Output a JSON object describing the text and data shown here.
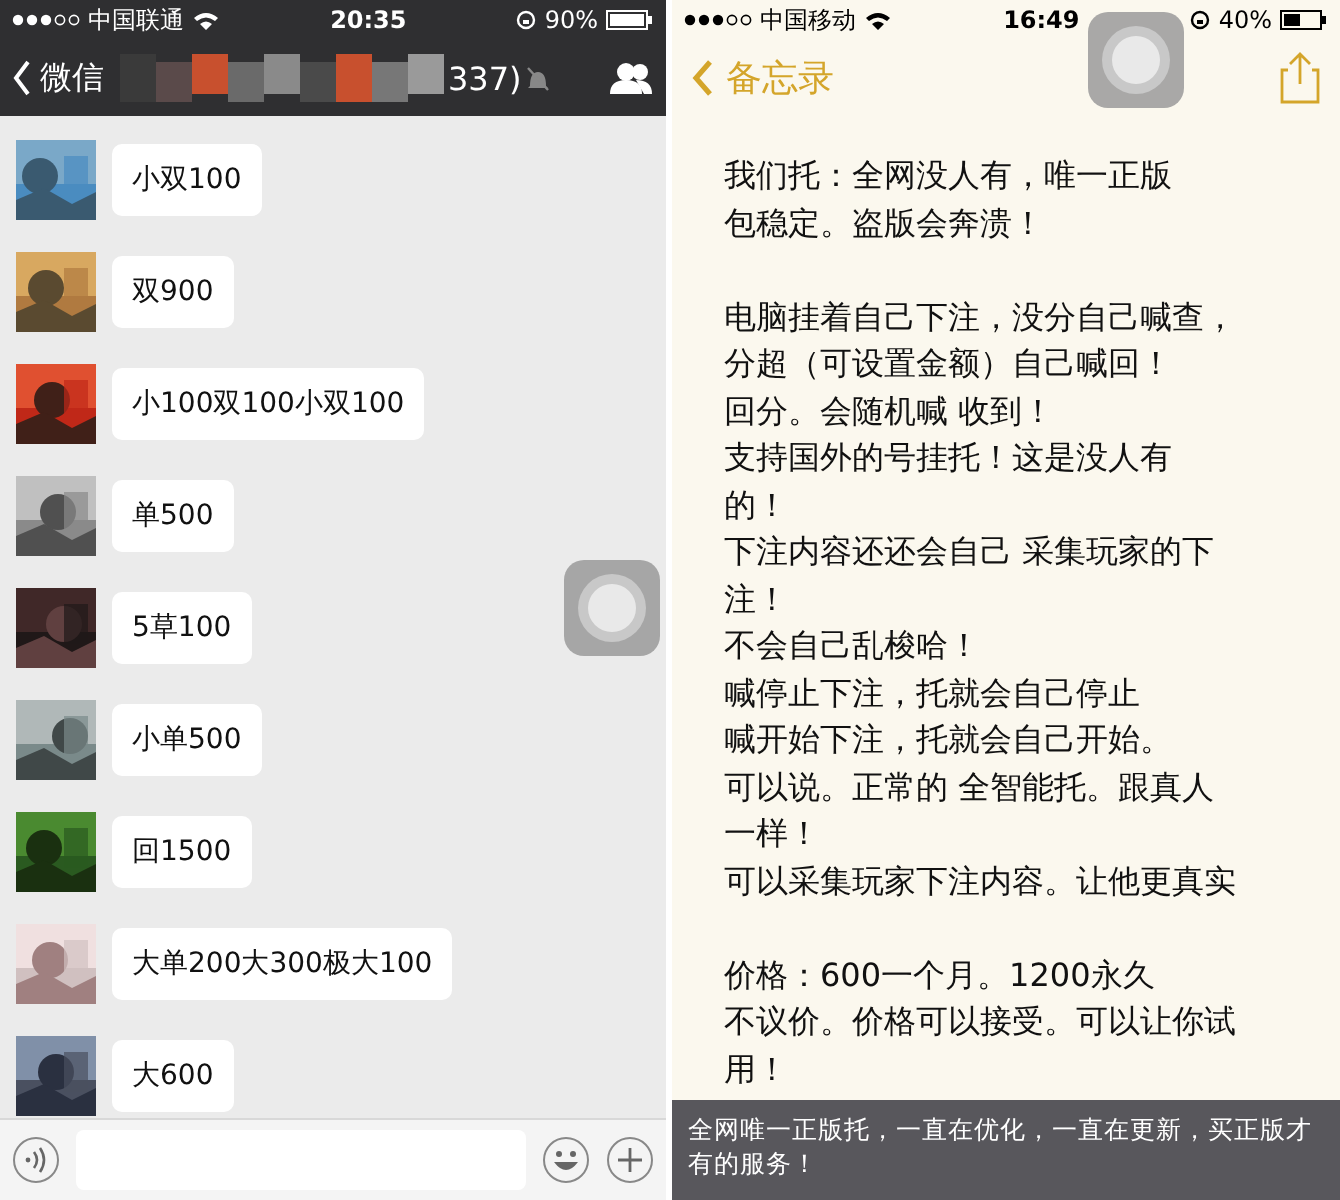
{
  "left_screen": {
    "status_bar": {
      "carrier": "中国联通",
      "time": "20:35",
      "battery": "90%"
    },
    "nav": {
      "back": "微信",
      "title": "337)"
    },
    "messages": [
      {
        "text": "小双100",
        "kind": "picture"
      },
      {
        "text": "双900",
        "kind": "picture"
      },
      {
        "text": "小100双100小双100",
        "kind": "picture"
      },
      {
        "text": "单500",
        "kind": "picture"
      },
      {
        "text": "5草100",
        "kind": "picture"
      },
      {
        "text": "小单500",
        "kind": "picture"
      },
      {
        "text": "回1500",
        "kind": "picture"
      },
      {
        "text": "大单200大300极大100",
        "kind": "picture"
      },
      {
        "text": "大600",
        "kind": "picture"
      }
    ]
  },
  "right_screen": {
    "status_bar": {
      "carrier": "中国移动",
      "time": "16:49",
      "battery": "40%"
    },
    "nav": {
      "back": "备忘录"
    },
    "note_paragraphs": [
      [
        "我们托：全网没人有，唯一正版",
        "包稳定。盗版会奔溃！"
      ],
      [
        "电脑挂着自己下注，没分自己喊查，",
        "分超（可设置金额）自己喊回！",
        "回分。会随机喊 收到！",
        "支持国外的号挂托！这是没人有",
        "的！",
        "下注内容还还会自己 采集玩家的下",
        "注！",
        "不会自己乱梭哈！",
        "喊停止下注，托就会自己停止",
        "喊开始下注，托就会自己开始。",
        "可以说。正常的 全智能托。跟真人",
        "一样！",
        "可以采集玩家下注内容。让他更真实"
      ],
      [
        "价格：600一个月。1200永久",
        "不议价。价格可以接受。可以让你试",
        "用！"
      ]
    ],
    "caption": "全网唯一正版托，一直在优化，一直在更新，买正版才有的服务！"
  }
}
